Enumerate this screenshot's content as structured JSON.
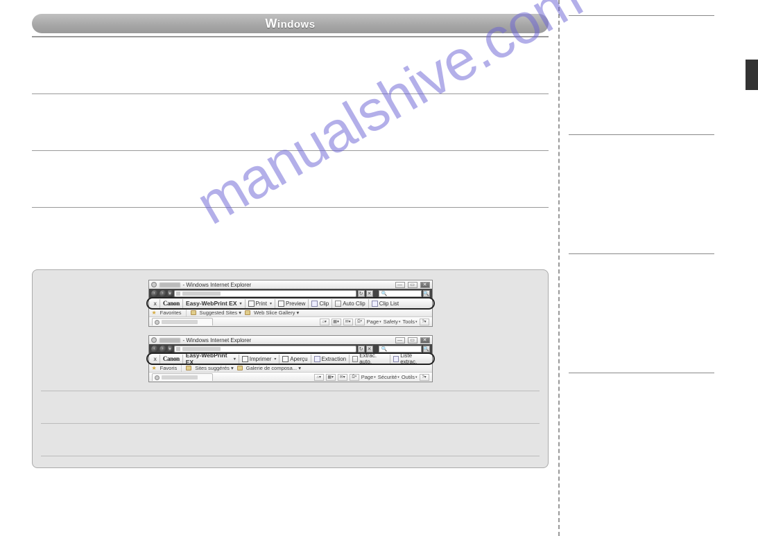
{
  "watermark": "manualshive.com",
  "header_badge": "Windows",
  "browser_shots": [
    {
      "title_suffix": " - Windows Internet Explorer",
      "toolbar": {
        "close": "x",
        "logo": "Canon",
        "product": "Easy-WebPrint EX",
        "buttons": [
          {
            "icon": "printer",
            "label": "Print",
            "dd": true
          },
          {
            "icon": "preview",
            "label": "Preview"
          },
          {
            "icon": "clip",
            "label": "Clip"
          },
          {
            "icon": "autoclip",
            "label": "Auto Clip"
          },
          {
            "icon": "cliplist",
            "label": "Clip List"
          }
        ]
      },
      "favbar": {
        "label": "Favorites",
        "items": [
          "Suggested Sites",
          "Web Slice Gallery"
        ]
      },
      "tabbar_tools": [
        "Page",
        "Safety",
        "Tools"
      ]
    },
    {
      "title_suffix": " - Windows Internet Explorer",
      "toolbar": {
        "close": "x",
        "logo": "Canon",
        "product": "Easy-WebPrint EX",
        "buttons": [
          {
            "icon": "printer",
            "label": "Imprimer",
            "dd": true
          },
          {
            "icon": "preview",
            "label": "Aperçu"
          },
          {
            "icon": "clip",
            "label": "Extraction"
          },
          {
            "icon": "autoclip",
            "label": "Extrac. auto."
          },
          {
            "icon": "cliplist",
            "label": "Liste extrac."
          }
        ]
      },
      "favbar": {
        "label": "Favoris",
        "items": [
          "Sites suggérés",
          "Galerie de composa..."
        ]
      },
      "tabbar_tools": [
        "Page",
        "Sécurité",
        "Outils"
      ]
    }
  ]
}
